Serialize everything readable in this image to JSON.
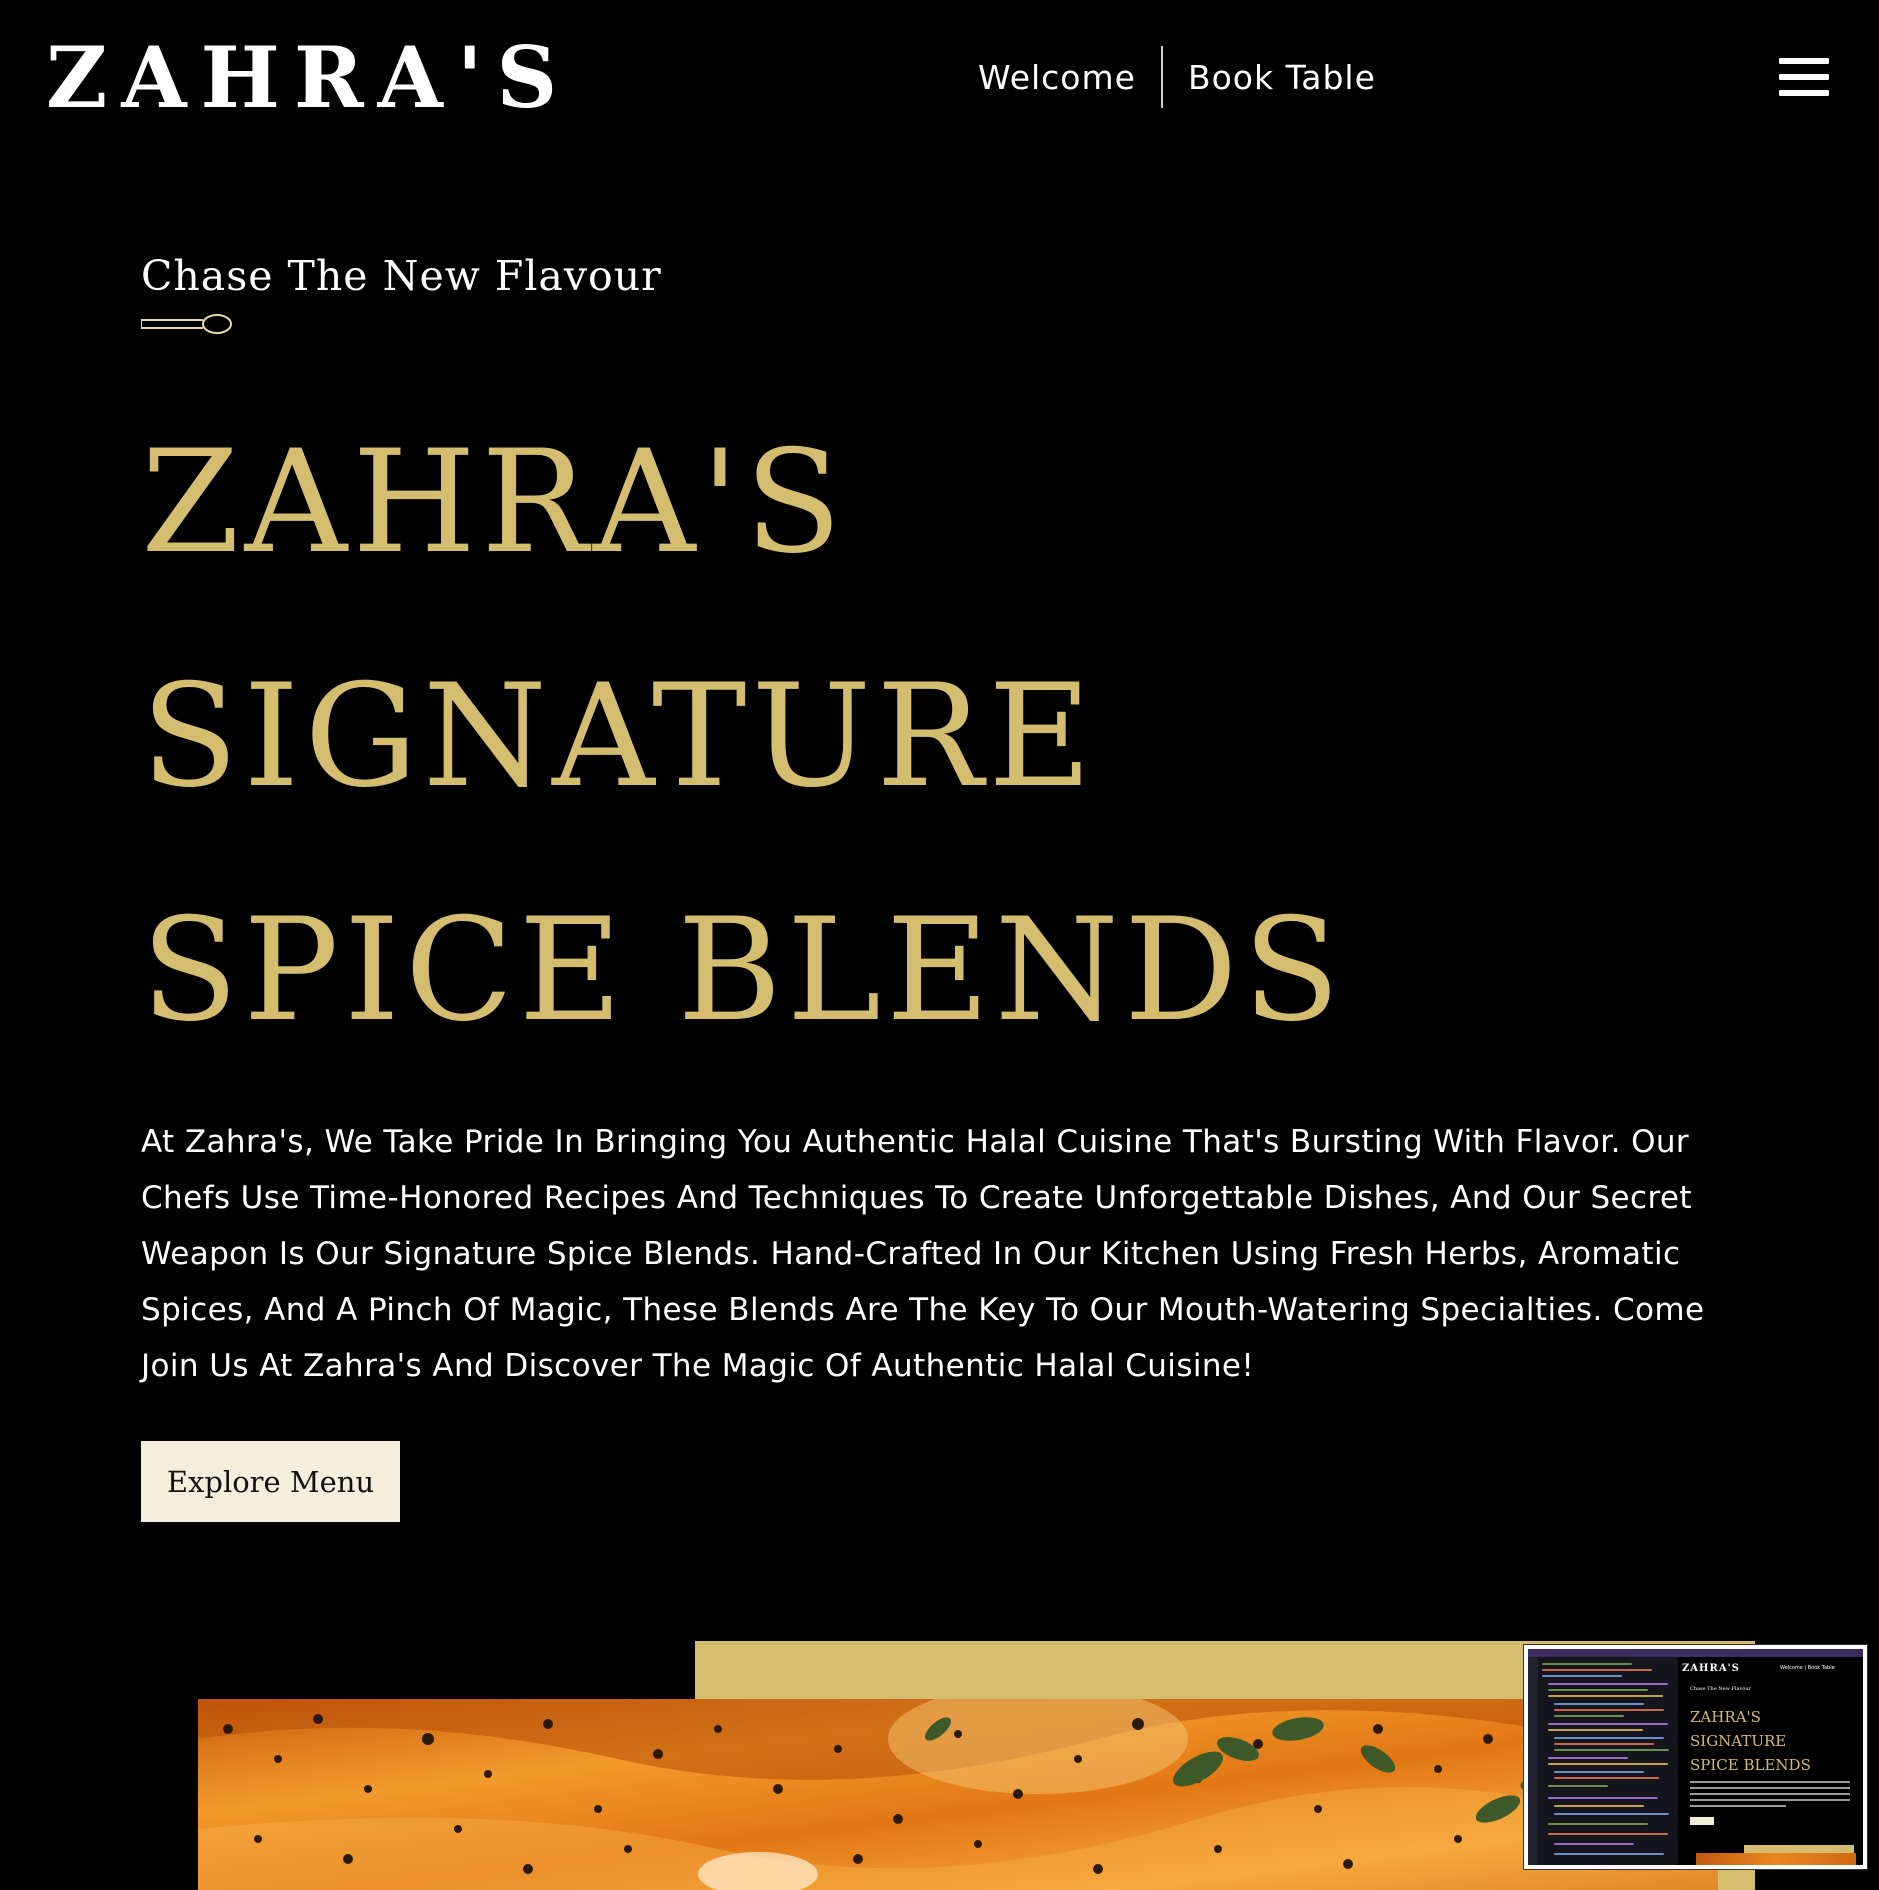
{
  "header": {
    "logo": "ZAHRA'S",
    "nav": [
      {
        "label": "Welcome"
      },
      {
        "label": "Book Table"
      }
    ],
    "menu_icon": "hamburger-menu-icon"
  },
  "hero": {
    "tagline": "Chase The New Flavour",
    "divider_icon": "spoon-icon",
    "title_lines": [
      "ZAHRA'S",
      "SIGNATURE",
      "SPICE BLENDS"
    ],
    "description": "At Zahra's, We Take Pride In Bringing You Authentic Halal Cuisine That's Bursting With Flavor. Our Chefs Use Time-Honored Recipes And Techniques To Create Unforgettable Dishes, And Our Secret Weapon Is Our Signature Spice Blends. Hand-Crafted In Our Kitchen Using Fresh Herbs, Aromatic Spices, And A Pinch Of Magic, These Blends Are The Key To Our Mouth-Watering Specialties. Come Join Us At Zahra's And Discover The Magic Of Authentic Halal Cuisine!",
    "cta_label": "Explore Menu"
  },
  "colors": {
    "background": "#000000",
    "accent_gold": "#d4bd6e",
    "button_bg": "#f4efdc",
    "text": "#ffffff"
  },
  "thumbnail": {
    "logo": "ZAHRA'S",
    "nav": "Welcome | Book Table",
    "tagline": "Chase The New Flavour",
    "title_lines": [
      "ZAHRA'S",
      "SIGNATURE",
      "SPICE BLENDS"
    ]
  }
}
